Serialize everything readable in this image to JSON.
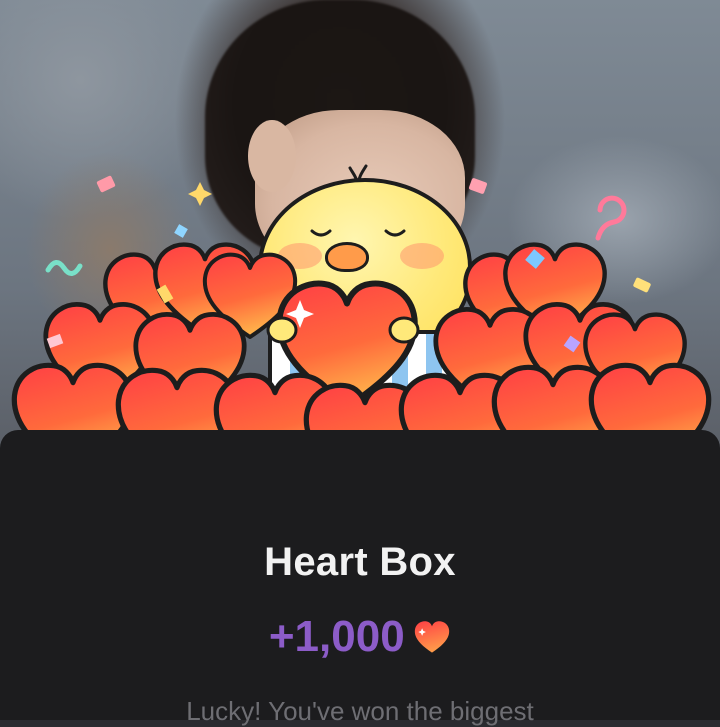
{
  "reward": {
    "title": "Heart Box",
    "amount": "+1,000",
    "amount_icon": "heart-icon",
    "description": "Lucky! You've won the biggest"
  },
  "colors": {
    "sheet_background": "#1c1c1e",
    "title_text": "#f2f2f2",
    "amount_text": "#8c5cc8",
    "description_text": "#6e6e73",
    "heart_fill": "#ff5a3a"
  },
  "illustration": {
    "character": "yellow-chick",
    "object": "heart-gift-box",
    "decoration": "confetti"
  }
}
